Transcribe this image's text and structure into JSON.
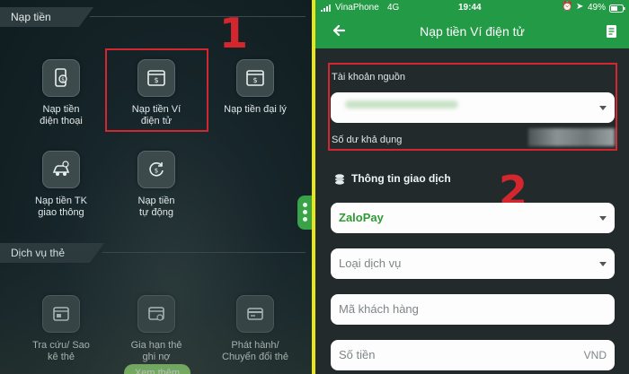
{
  "left": {
    "section1_title": "Nạp tiền",
    "section2_title": "Dịch vụ thẻ",
    "items": [
      {
        "label1": "Nạp tiền",
        "label2": "điện thoại",
        "icon": "phone-money-icon"
      },
      {
        "label1": "Nạp tiền Ví",
        "label2": "điện tử",
        "icon": "e-wallet-icon"
      },
      {
        "label1": "Nạp tiền đại lý",
        "label2": "",
        "icon": "agent-topup-icon"
      },
      {
        "label1": "Nạp tiền TK",
        "label2": "giao thông",
        "icon": "car-icon"
      },
      {
        "label1": "Nạp tiền",
        "label2": "tự động",
        "icon": "auto-topup-icon"
      }
    ],
    "card_items": [
      {
        "label1": "Tra cứu/ Sao",
        "label2": "kê thẻ",
        "icon": "card-lookup-icon"
      },
      {
        "label1": "Gia hạn thẻ",
        "label2": "ghi nợ",
        "icon": "card-renew-icon"
      },
      {
        "label1": "Phát hành/",
        "label2": "Chuyển đổi thẻ",
        "icon": "card-issue-icon"
      }
    ],
    "more_button": "Xem thêm",
    "step_number": "1",
    "highlight_color": "#d3262e"
  },
  "status": {
    "carrier": "VinaPhone",
    "network": "4G",
    "time": "19:44",
    "battery": "49%"
  },
  "right": {
    "title": "Nạp tiền Ví điện tử",
    "source_account_label": "Tài khoản nguồn",
    "balance_label": "Số dư khả dụng",
    "transaction_info_label": "Thông tin giao dịch",
    "wallet_value": "ZaloPay",
    "service_placeholder": "Loại dịch vụ",
    "customer_code_placeholder": "Mã khách hàng",
    "amount_placeholder": "Số tiền",
    "currency": "VND",
    "step_number": "2",
    "brand_green": "#239a45"
  }
}
